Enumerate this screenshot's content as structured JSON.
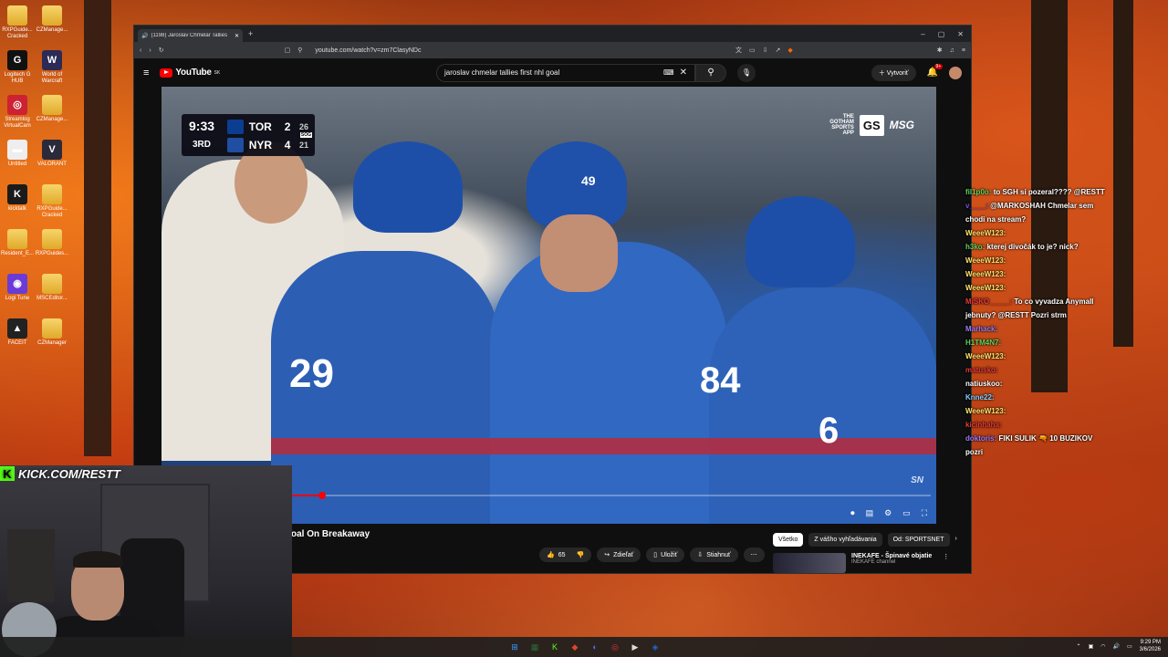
{
  "desktop": {
    "icons": [
      {
        "label": "RXPGuide... Cracked",
        "kind": "folder"
      },
      {
        "label": "CZManage...",
        "kind": "folder"
      },
      {
        "label": "Logitech G HUB",
        "kind": "app",
        "glyph": "G",
        "color": "#111"
      },
      {
        "label": "World of Warcraft",
        "kind": "app",
        "glyph": "W",
        "color": "#2b2b55"
      },
      {
        "label": "Streamlog VirtualCam",
        "kind": "app",
        "glyph": "◎",
        "color": "#c23"
      },
      {
        "label": "CZManage...",
        "kind": "folder"
      },
      {
        "label": "Untitled",
        "kind": "file",
        "glyph": "▬",
        "color": "#eee"
      },
      {
        "label": "VALORANT",
        "kind": "app",
        "glyph": "V",
        "color": "#2a2a3a"
      },
      {
        "label": "kicktalk",
        "kind": "app",
        "glyph": "K",
        "color": "#1b1b1b"
      },
      {
        "label": "RXPGuide... Cracked",
        "kind": "folder"
      },
      {
        "label": "Resident_E...",
        "kind": "folder"
      },
      {
        "label": "RXPGuides...",
        "kind": "folder"
      },
      {
        "label": "Logi Tune",
        "kind": "app",
        "glyph": "◉",
        "color": "#6a3bd6"
      },
      {
        "label": "MSCEditor...",
        "kind": "folder"
      },
      {
        "label": "FACEIT",
        "kind": "app",
        "glyph": "▲",
        "color": "#222"
      },
      {
        "label": "CZManager",
        "kind": "folder"
      }
    ]
  },
  "browser": {
    "tab_title": "(1198) Jaroslav Chmelar Tallies",
    "url": "youtube.com/watch?v=zm7ClasyNDc",
    "window_controls": [
      "–",
      "▢",
      "✕"
    ]
  },
  "youtube": {
    "logo_text": "YouTube",
    "logo_superscript": "SK",
    "search_query": "jaroslav chmelar tallies first nhl goal",
    "create_label": "Vytvoriť",
    "notif_count": "9+"
  },
  "video": {
    "scorebug": {
      "clock": "9:33",
      "period": "3RD",
      "sog_label": "SOG",
      "teams": [
        {
          "abbr": "TOR",
          "score": "2",
          "sog": "26",
          "color": "#0b3d91"
        },
        {
          "abbr": "NYR",
          "score": "4",
          "sog": "21",
          "color": "#1f4ea3"
        }
      ]
    },
    "broadcaster": {
      "gs_line1": "THE",
      "gs_line2": "GOTHAM",
      "gs_line3": "SPORTS",
      "gs_line4": "APP",
      "gs_badge": "GS",
      "network": "MSG"
    },
    "sn_bug": "SN",
    "jersey_numbers": [
      "29",
      "49",
      "84",
      "6"
    ],
    "progress_fraction": 0.07
  },
  "below": {
    "title_fragment": "oal On Breakaway",
    "actions": [
      {
        "icon": "thumbs-up",
        "label": "65"
      },
      {
        "icon": "share",
        "label": "Zdieľať"
      },
      {
        "icon": "bookmark",
        "label": "Uložiť"
      },
      {
        "icon": "download",
        "label": "Stiahnuť"
      }
    ],
    "more_label": "⋯",
    "chips": [
      "Všetko",
      "Z vášho vyhľadávania",
      "Od: SPORTSNET"
    ],
    "rec_title": "INEKAFE - Špinavé objatie",
    "rec_channel": "INEKAFE channel"
  },
  "chat": [
    {
      "user": "fil1p0o:",
      "text": "to SGH si pozeral???? @RESTT",
      "color": "#5fd35f"
    },
    {
      "user": "v____:",
      "text": "@MARKOSHAH Chmelar sem chodi na stream?",
      "color": "#7a4fd8"
    },
    {
      "user": "WeeeW123:",
      "text": "",
      "color": "#ffe36b"
    },
    {
      "user": "h3ko:",
      "text": "kterej divočák to je? nick?",
      "color": "#5fd35f"
    },
    {
      "user": "WeeeW123:",
      "text": "",
      "color": "#ffe36b"
    },
    {
      "user": "WeeeW123:",
      "text": "",
      "color": "#ffe36b"
    },
    {
      "user": "WeeeW123:",
      "text": "",
      "color": "#ffe36b"
    },
    {
      "user": "MiSKO_____:",
      "text": "To co vyvadza Anymall jebnuty? @RESTT Pozri strm",
      "color": "#e83a3a"
    },
    {
      "user": "Marhack:",
      "text": "",
      "color": "#9a7cff"
    },
    {
      "user": "H1TM4N7:",
      "text": "",
      "color": "#5fd35f"
    },
    {
      "user": "WeeeW123:",
      "text": "",
      "color": "#ffe36b"
    },
    {
      "user": "matusko:",
      "text": "",
      "color": "#e83a3a"
    },
    {
      "user": "natiuskoo:",
      "text": "",
      "color": "#ffffff"
    },
    {
      "user": "Knne22:",
      "text": "",
      "color": "#7fd0ff"
    },
    {
      "user": "WeeeW123:",
      "text": "",
      "color": "#ffe36b"
    },
    {
      "user": "kicinhaha:",
      "text": "",
      "color": "#e83a3a"
    },
    {
      "user": "doktoris:",
      "text": "FIKI SULIK 🔫 10 BUZIKOV pozri",
      "color": "#9a7cff"
    }
  ],
  "stream": {
    "kick_url": "KICK.COM/RESTT"
  },
  "taskbar": {
    "time": "9:29 PM",
    "date": "3/6/2026",
    "icons": [
      {
        "glyph": "⊞",
        "color": "#3a9cff"
      },
      {
        "glyph": "▦",
        "color": "#2b6a3b"
      },
      {
        "glyph": "K",
        "color": "#53fc18"
      },
      {
        "glyph": "◆",
        "color": "#e0452a"
      },
      {
        "glyph": "◐",
        "color": "#5865f2"
      },
      {
        "glyph": "◎",
        "color": "#e33"
      },
      {
        "glyph": "▶",
        "color": "#ddd"
      },
      {
        "glyph": "◈",
        "color": "#1b6ac9"
      }
    ]
  }
}
